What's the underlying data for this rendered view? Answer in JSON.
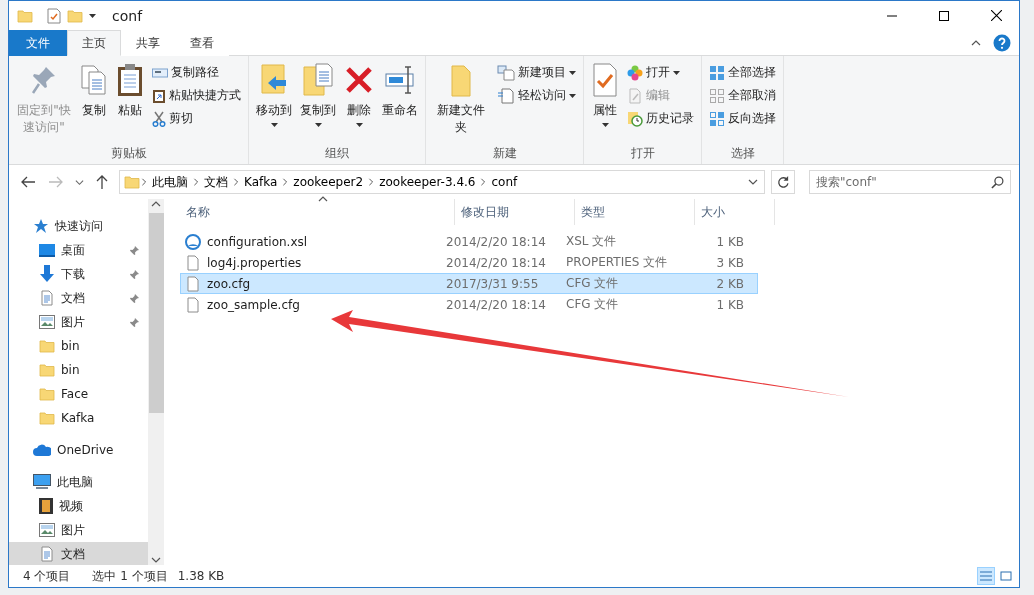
{
  "window": {
    "title": "conf"
  },
  "ribbon_tabs": [
    {
      "label": "文件",
      "kind": "file",
      "selected": false
    },
    {
      "label": "主页",
      "kind": "tab",
      "selected": true
    },
    {
      "label": "共享",
      "kind": "tab",
      "selected": false
    },
    {
      "label": "查看",
      "kind": "tab",
      "selected": false
    }
  ],
  "ribbon_groups": [
    {
      "label": "剪贴板",
      "commands": [
        {
          "label": "固定到\"快速访问\"",
          "kind": "large",
          "disabled": true,
          "dropdown": false
        },
        {
          "label": "复制",
          "kind": "large",
          "disabled": false,
          "dropdown": false
        },
        {
          "label": "粘贴",
          "kind": "large",
          "disabled": false,
          "dropdown": false
        },
        {
          "label": "复制路径",
          "kind": "small",
          "disabled": false,
          "dropdown": false
        },
        {
          "label": "粘贴快捷方式",
          "kind": "small",
          "disabled": false,
          "dropdown": false
        },
        {
          "label": "剪切",
          "kind": "small",
          "disabled": false,
          "dropdown": false
        }
      ]
    },
    {
      "label": "组织",
      "commands": [
        {
          "label": "移动到",
          "kind": "large",
          "disabled": false,
          "dropdown": true
        },
        {
          "label": "复制到",
          "kind": "large",
          "disabled": false,
          "dropdown": true
        },
        {
          "label": "删除",
          "kind": "large",
          "disabled": false,
          "dropdown": true
        },
        {
          "label": "重命名",
          "kind": "large",
          "disabled": false,
          "dropdown": false
        }
      ]
    },
    {
      "label": "新建",
      "commands": [
        {
          "label": "新建文件夹",
          "kind": "large",
          "disabled": false,
          "dropdown": false
        },
        {
          "label": "新建项目",
          "kind": "small",
          "disabled": false,
          "dropdown": true
        },
        {
          "label": "轻松访问",
          "kind": "small",
          "disabled": false,
          "dropdown": true
        }
      ]
    },
    {
      "label": "打开",
      "commands": [
        {
          "label": "属性",
          "kind": "large",
          "disabled": false,
          "dropdown": true
        },
        {
          "label": "打开",
          "kind": "small",
          "disabled": false,
          "dropdown": true
        },
        {
          "label": "编辑",
          "kind": "small",
          "disabled": true,
          "dropdown": false
        },
        {
          "label": "历史记录",
          "kind": "small",
          "disabled": false,
          "dropdown": false
        }
      ]
    },
    {
      "label": "选择",
      "commands": [
        {
          "label": "全部选择",
          "kind": "small",
          "disabled": false,
          "dropdown": false
        },
        {
          "label": "全部取消",
          "kind": "small",
          "disabled": false,
          "dropdown": false
        },
        {
          "label": "反向选择",
          "kind": "small",
          "disabled": false,
          "dropdown": false
        }
      ]
    }
  ],
  "address_bar": {
    "breadcrumbs": [
      "此电脑",
      "文档",
      "Kafka",
      "zookeeper2",
      "zookeeper-3.4.6",
      "conf"
    ]
  },
  "search": {
    "placeholder": "搜索\"conf\""
  },
  "navigation": [
    {
      "label": "快速访问",
      "selected": false,
      "pinned": false,
      "children": [
        {
          "label": "桌面",
          "selected": false,
          "pinned": true
        },
        {
          "label": "下载",
          "selected": false,
          "pinned": true
        },
        {
          "label": "文档",
          "selected": false,
          "pinned": true
        },
        {
          "label": "图片",
          "selected": false,
          "pinned": true
        },
        {
          "label": "bin",
          "selected": false,
          "pinned": false
        },
        {
          "label": "bin",
          "selected": false,
          "pinned": false
        },
        {
          "label": "Face",
          "selected": false,
          "pinned": false
        },
        {
          "label": "Kafka",
          "selected": false,
          "pinned": false
        }
      ]
    },
    {
      "label": "OneDrive",
      "selected": false,
      "pinned": false
    },
    {
      "label": "此电脑",
      "selected": false,
      "pinned": false,
      "children": [
        {
          "label": "视频",
          "selected": false,
          "pinned": false
        },
        {
          "label": "图片",
          "selected": false,
          "pinned": false
        },
        {
          "label": "文档",
          "selected": true,
          "pinned": false
        }
      ]
    }
  ],
  "table": {
    "columns": [
      "名称",
      "修改日期",
      "类型",
      "大小"
    ],
    "rows": [
      {
        "name": "configuration.xsl",
        "modified": "2014/2/20 18:14",
        "type": "XSL 文件",
        "size": "1 KB",
        "selected": false
      },
      {
        "name": "log4j.properties",
        "modified": "2014/2/20 18:14",
        "type": "PROPERTIES 文件",
        "size": "3 KB",
        "selected": false
      },
      {
        "name": "zoo.cfg",
        "modified": "2017/3/31 9:55",
        "type": "CFG 文件",
        "size": "2 KB",
        "selected": true
      },
      {
        "name": "zoo_sample.cfg",
        "modified": "2014/2/20 18:14",
        "type": "CFG 文件",
        "size": "1 KB",
        "selected": false
      }
    ]
  },
  "status_bar": {
    "item_count": "4 个项目",
    "selection": "选中 1 个项目",
    "selection_size": "1.38 KB"
  },
  "view_buttons": [
    {
      "kind": "details",
      "selected": true
    },
    {
      "kind": "large_icons",
      "selected": false
    }
  ]
}
